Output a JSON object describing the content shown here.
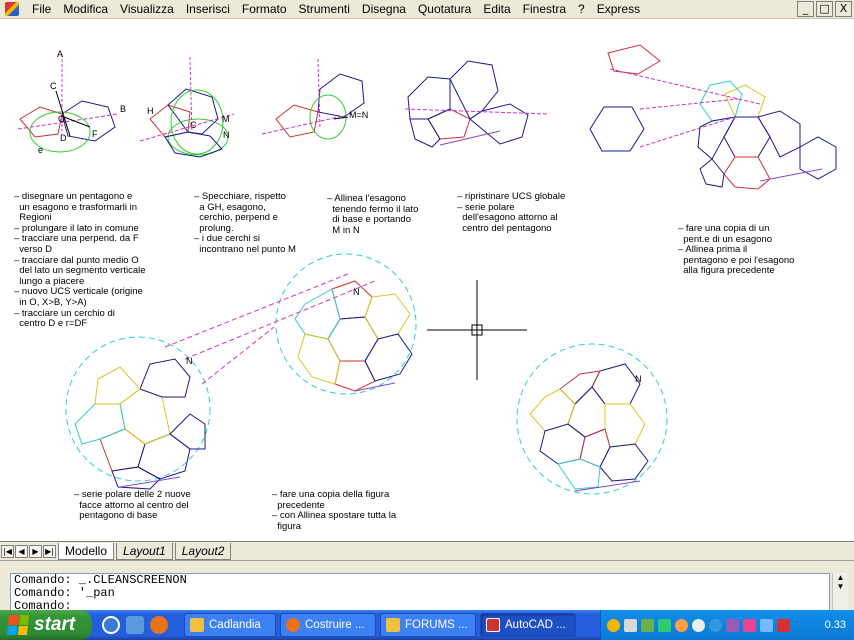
{
  "menubar": {
    "items": [
      "File",
      "Modifica",
      "Visualizza",
      "Inserisci",
      "Formato",
      "Strumenti",
      "Disegna",
      "Quotatura",
      "Edita",
      "Finestra",
      "?",
      "Express"
    ],
    "controls": [
      "_",
      "□",
      "X"
    ]
  },
  "drawing": {
    "labels": {
      "A": "A",
      "C": "C",
      "B": "B",
      "O": "O",
      "D": "D",
      "F": "F",
      "e": "e",
      "H": "H",
      "C2": "C",
      "M": "M",
      "N": "N",
      "MN": "M=N",
      "N_ball1": "N",
      "N_ball2": "N",
      "N_ball3": "N"
    },
    "notes": {
      "step1": "– disegnare un pentagono e\n  un esagono e trasformarli in\n  Regioni\n– prolungare il lato in comune\n– tracciare una perpend. da F\n  verso D\n– tracciare dal punto medio O\n  del lato un segmento verticale\n  lungo a piacere\n– nuovo UCS verticale (origine\n  in O, X>B, Y>A)\n– tracciare un cerchio di\n  centro D e r=DF",
      "step2": "– Specchiare, rispetto\n  a GH, esagono,\n  cerchio, perpend e\n  prolung.\n– i due cerchi si\n  incontrano nel punto M",
      "step3": "– Allinea l'esagono\n  tenendo fermo il lato\n  di base e portando\n  M in N",
      "step4": "– ripristinare UCS globale\n– serie polare\n  dell'esagono attorno al\n  centro del pentagono",
      "step5": "– fare una copia di un\n  pent.e di un esagono\n– Allinea prima il\n  pentagono e poi l'esagono\n  alla figura precedente",
      "step6": "– serie polare delle 2 nuove\n  facce attorno al centro del\n  pentagono di base",
      "step7": "– fare una copia della figura\n  precedente\n– con Allinea spostare tutta la\n  figura"
    },
    "colors": {
      "magenta": "#cc33cc",
      "green": "#33cc33",
      "navy": "#1a1a8c",
      "cyan": "#33cccc",
      "yellow": "#d8c820",
      "red": "#cc3333",
      "purple": "#8844cc"
    }
  },
  "tabs": {
    "nav": [
      "|◀",
      "◀",
      "▶",
      "▶|"
    ],
    "items": [
      "Modello",
      "Layout1",
      "Layout2"
    ],
    "active": "Modello"
  },
  "command": {
    "lines": [
      "Comando: _.CLEANSCREENON",
      "Comando: '_pan",
      "Comando:"
    ]
  },
  "taskbar": {
    "start_label": "start",
    "tasks": [
      {
        "label": "Cadlandia",
        "icon": "folder-icon"
      },
      {
        "label": "Costruire ...",
        "icon": "firefox-icon"
      },
      {
        "label": "FORUMS ...",
        "icon": "folder-icon"
      },
      {
        "label": "AutoCAD ...",
        "icon": "autocad-icon"
      }
    ],
    "clock": "0.33"
  }
}
